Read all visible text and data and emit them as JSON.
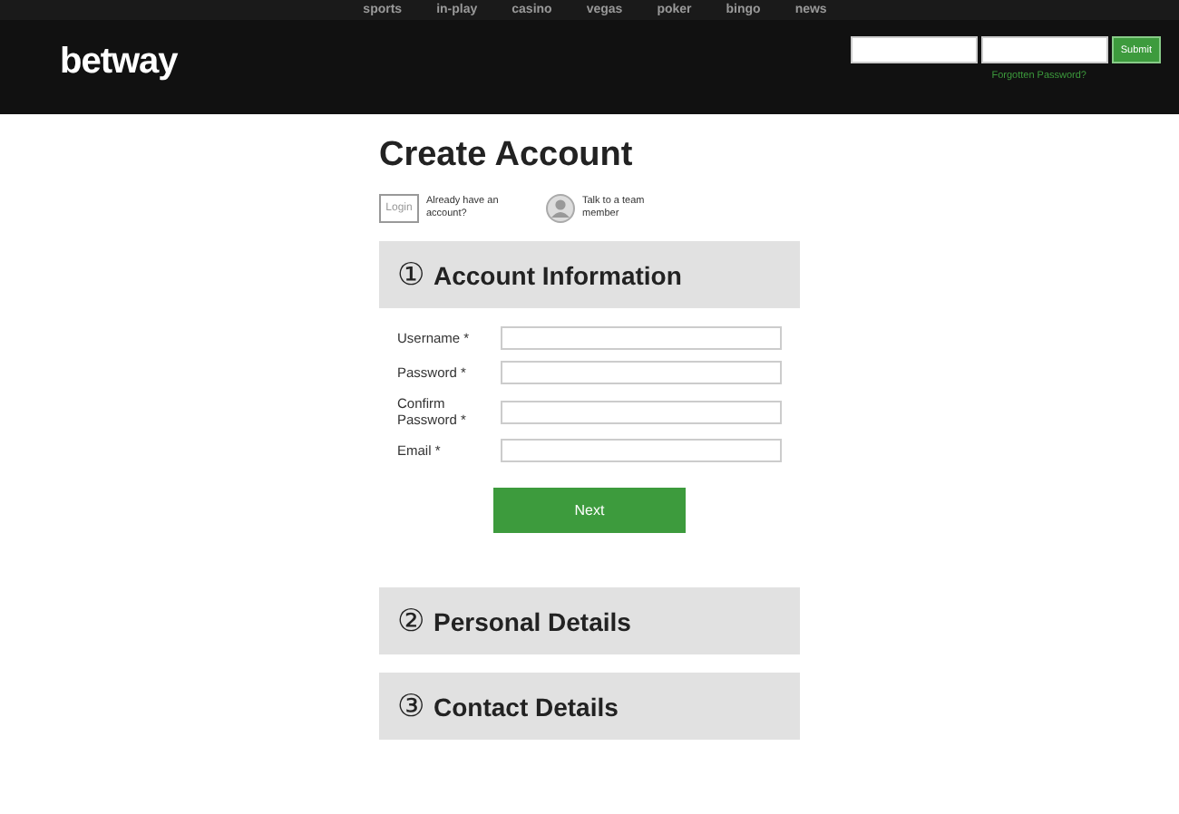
{
  "nav": [
    "sports",
    "in-play",
    "casino",
    "vegas",
    "poker",
    "bingo",
    "news"
  ],
  "logo": "betway",
  "header_login": {
    "submit": "Submit",
    "forgot": "Forgotten Password?"
  },
  "title": "Create Account",
  "login": {
    "button": "Login",
    "text": "Already have an account?"
  },
  "talk": {
    "text": "Talk to a team member"
  },
  "sections": [
    {
      "number": "①",
      "title": "Account Information",
      "fields": [
        {
          "label": "Username *"
        },
        {
          "label": "Password *"
        },
        {
          "label": "Confirm Password *"
        },
        {
          "label": "Email *"
        }
      ],
      "next": "Next"
    },
    {
      "number": "②",
      "title": "Personal Details"
    },
    {
      "number": "③",
      "title": "Contact Details"
    }
  ]
}
